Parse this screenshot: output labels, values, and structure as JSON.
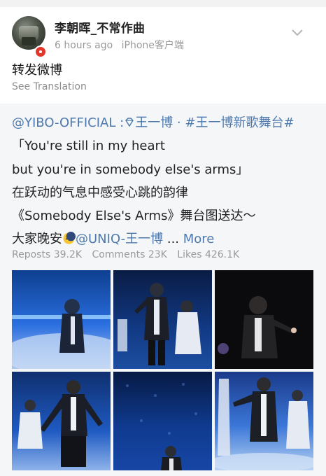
{
  "post": {
    "username": "李朝晖_不常作曲",
    "time": "6 hours ago",
    "source": "iPhone客户端",
    "text": "转发微博",
    "see_translation": "See Translation"
  },
  "repost": {
    "mention_prefix": "@YIBO-OFFICIAL",
    "colon": " :",
    "tag_name": "王一博",
    "dot": " · ",
    "hashtag": "#王一博新歌舞台#",
    "line2": "「You're still in my heart",
    "line3": "but you're in somebody else's arms」",
    "line4": "在跃动的气息中感受心跳的韵律",
    "line5": "《Somebody Else's Arms》舞台图送达～",
    "line6_prefix": "大家晚安",
    "line6_mention": "@UNIQ-王一博",
    "line6_ellipsis": " ... ",
    "more": "More",
    "reposts": "Reposts 39.2K",
    "comments": "Comments 23K",
    "likes": "Likes 426.1K"
  },
  "icons": {
    "verified_badge": "verified-badge-icon",
    "chevron": "chevron-down-icon",
    "diamond": "diamond-icon",
    "moon_emoji": "sleepy-moon-emoji-icon"
  },
  "colors": {
    "link": "#4d79ad",
    "badge": "#e2362a",
    "repost_bg": "#f5f6f8"
  }
}
